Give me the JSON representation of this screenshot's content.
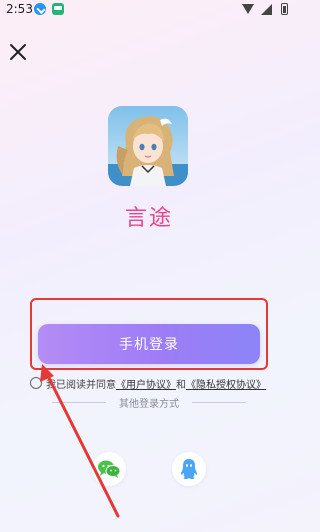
{
  "status_bar": {
    "time": "2:53"
  },
  "app": {
    "name": "言途"
  },
  "login": {
    "phone_login_label": "手机登录"
  },
  "agreement": {
    "prefix": "我已阅读并同意",
    "user_agreement": "《用户协议》",
    "conjunction": "和",
    "privacy_agreement": "《隐私授权协议》"
  },
  "other_login": {
    "label": "其他登录方式"
  },
  "colors": {
    "accent_pink": "#e9458f",
    "button_purple": "#9d7cf6",
    "annotation_red": "#e53935",
    "wechat_green": "#4cc24c",
    "qq_blue": "#4aa6f5"
  },
  "icons": {
    "close": "close-icon",
    "wechat": "wechat-icon",
    "qq": "qq-icon"
  }
}
